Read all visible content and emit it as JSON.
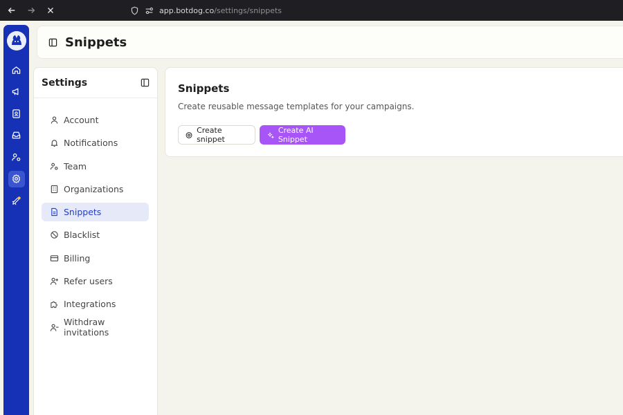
{
  "browser": {
    "url_host": "app.botdog.co",
    "url_path": "/settings/snippets"
  },
  "rail": {
    "items": [
      {
        "icon": "home-icon"
      },
      {
        "icon": "megaphone-icon"
      },
      {
        "icon": "contact-card-icon"
      },
      {
        "icon": "inbox-icon"
      },
      {
        "icon": "user-settings-icon"
      },
      {
        "icon": "gear-icon",
        "active": true
      },
      {
        "icon": "rocket-icon"
      }
    ]
  },
  "header": {
    "title": "Snippets"
  },
  "settings": {
    "title": "Settings",
    "items": [
      {
        "label": "Account",
        "icon": "user-icon"
      },
      {
        "label": "Notifications",
        "icon": "bell-icon"
      },
      {
        "label": "Team",
        "icon": "team-icon"
      },
      {
        "label": "Organizations",
        "icon": "building-icon"
      },
      {
        "label": "Snippets",
        "icon": "document-icon",
        "active": true
      },
      {
        "label": "Blacklist",
        "icon": "ban-icon"
      },
      {
        "label": "Billing",
        "icon": "credit-card-icon"
      },
      {
        "label": "Refer users",
        "icon": "user-plus-icon"
      },
      {
        "label": "Integrations",
        "icon": "puzzle-icon"
      },
      {
        "label": "Withdraw invitations",
        "icon": "user-minus-icon"
      }
    ]
  },
  "main": {
    "title": "Snippets",
    "description": "Create reusable message templates for your campaigns.",
    "create_snippet_label": "Create snippet",
    "create_ai_snippet_label": "Create AI Snippet"
  },
  "colors": {
    "rail": "#1631b5",
    "accent_purple": "#a855f7",
    "active_text": "#2140c8"
  }
}
